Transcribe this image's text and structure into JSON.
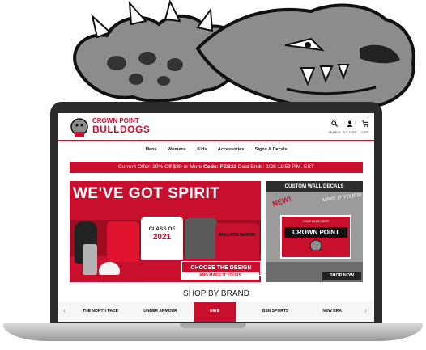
{
  "store": {
    "brand_line1": "CROWN POINT",
    "brand_line2": "BULLDOGS"
  },
  "header_icons": [
    {
      "name": "search-icon",
      "label": "SEARCH"
    },
    {
      "name": "account-icon",
      "label": "ACCOUNT"
    },
    {
      "name": "cart-icon",
      "label": "CART"
    }
  ],
  "nav": [
    "Mens",
    "Womens",
    "Kids",
    "Accessories",
    "Signs & Decals"
  ],
  "offer": {
    "prefix": "Current Offer: 20% Off $80 or More ",
    "code_label": "Code: FEB22",
    "suffix": " Deal Ends: 2/28 11:59 P.M. EST"
  },
  "hero": {
    "title": "WE'VE GOT SPIRIT",
    "shirt_class": "CLASS OF",
    "shirt_year": "2021",
    "shirt_nation": "BULLDOG NATION",
    "choose": "CHOOSE THE DESIGN",
    "make": "AND MAKE IT YOURS"
  },
  "decals": {
    "heading": "CUSTOM WALL DECALS",
    "new": "NEW!",
    "make": "MAKE IT YOURS!",
    "name_here": "YOUR NAME HERE",
    "crown": "CROWN POINT",
    "shop": "SHOP NOW"
  },
  "shop_by_brand": "SHOP BY BRAND",
  "brands": [
    "THE NORTH FACE",
    "UNDER ARMOUR",
    "NIKE",
    "BSN SPORTS",
    "NEW ERA"
  ],
  "colors": {
    "accent": "#c8102e",
    "dark": "#2b2b2b"
  }
}
